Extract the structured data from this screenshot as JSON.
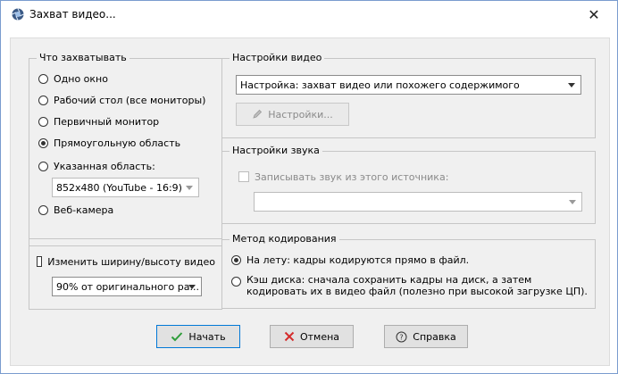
{
  "window": {
    "title": "Захват видео..."
  },
  "capture_group": {
    "legend": "Что захватывать",
    "options": [
      {
        "label": "Одно окно",
        "selected": false
      },
      {
        "label": "Рабочий стол (все мониторы)",
        "selected": false
      },
      {
        "label": "Первичный монитор",
        "selected": false
      },
      {
        "label": "Прямоугольную область",
        "selected": true
      },
      {
        "label": "Указанная область:",
        "selected": false
      },
      {
        "label": "Веб-камера",
        "selected": false
      }
    ],
    "area_select": "852x480 (YouTube - 16:9)"
  },
  "resize_group": {
    "checkbox_label": "Изменить ширину/высоту видео",
    "checked": false,
    "select_value": "90% от оригинального ра..."
  },
  "video_group": {
    "legend": "Настройки видео",
    "select_value": "Настройка: захват видео или похожего содержимого",
    "settings_button": "Настройки..."
  },
  "audio_group": {
    "legend": "Настройки звука",
    "checkbox_label": "Записывать звук из этого источника:",
    "select_value": ""
  },
  "encoding_group": {
    "legend": "Метод кодирования",
    "option_live": "На лету: кадры кодируются прямо в файл.",
    "option_cache": "Кэш диска: сначала сохранить кадры на диск, а затем кодировать их в видео файл (полезно при высокой загрузке ЦП).",
    "selected": "live"
  },
  "buttons": {
    "start": "Начать",
    "cancel": "Отмена",
    "help": "Справка"
  }
}
